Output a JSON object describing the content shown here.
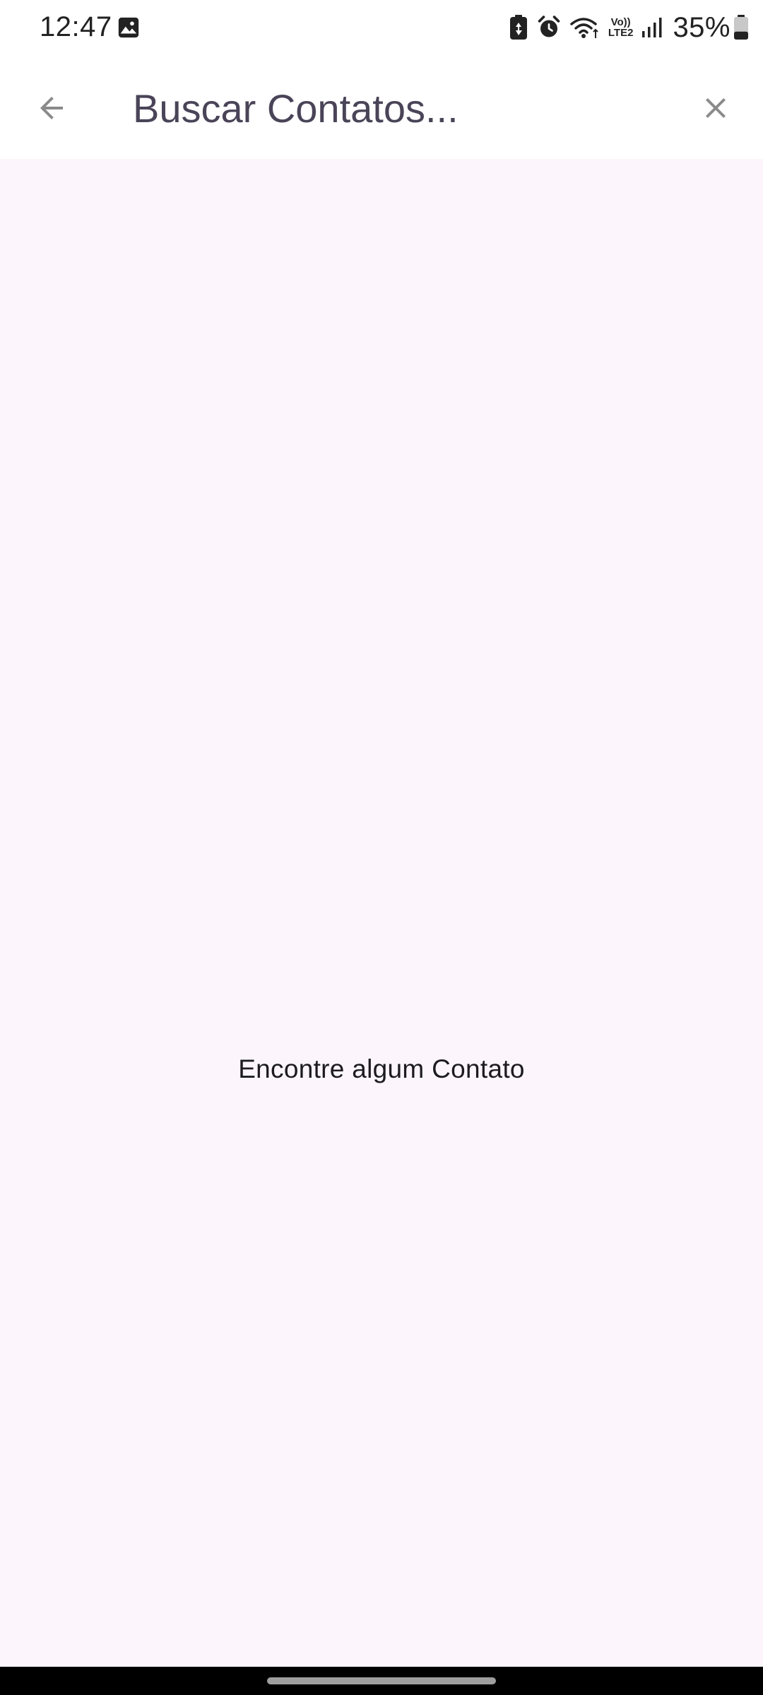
{
  "status_bar": {
    "time": "12:47",
    "battery_percent": "35%",
    "battery_level": 0.35,
    "icons": [
      "gallery-icon",
      "battery-saver-icon",
      "alarm-icon",
      "wifi-icon",
      "volte-icon",
      "signal-icon",
      "battery-icon"
    ],
    "volte_label_top": "Vo))",
    "volte_label_bottom": "LTE2"
  },
  "app_bar": {
    "back_icon": "arrow-back-icon",
    "search_placeholder": "Buscar Contatos...",
    "search_value": "",
    "clear_icon": "close-icon"
  },
  "content": {
    "empty_message": "Encontre algum Contato"
  },
  "colors": {
    "background": "#fcf6fc",
    "app_bar": "#ffffff",
    "hint_text": "#4a4458",
    "icon_gray": "#8a8a8a"
  }
}
